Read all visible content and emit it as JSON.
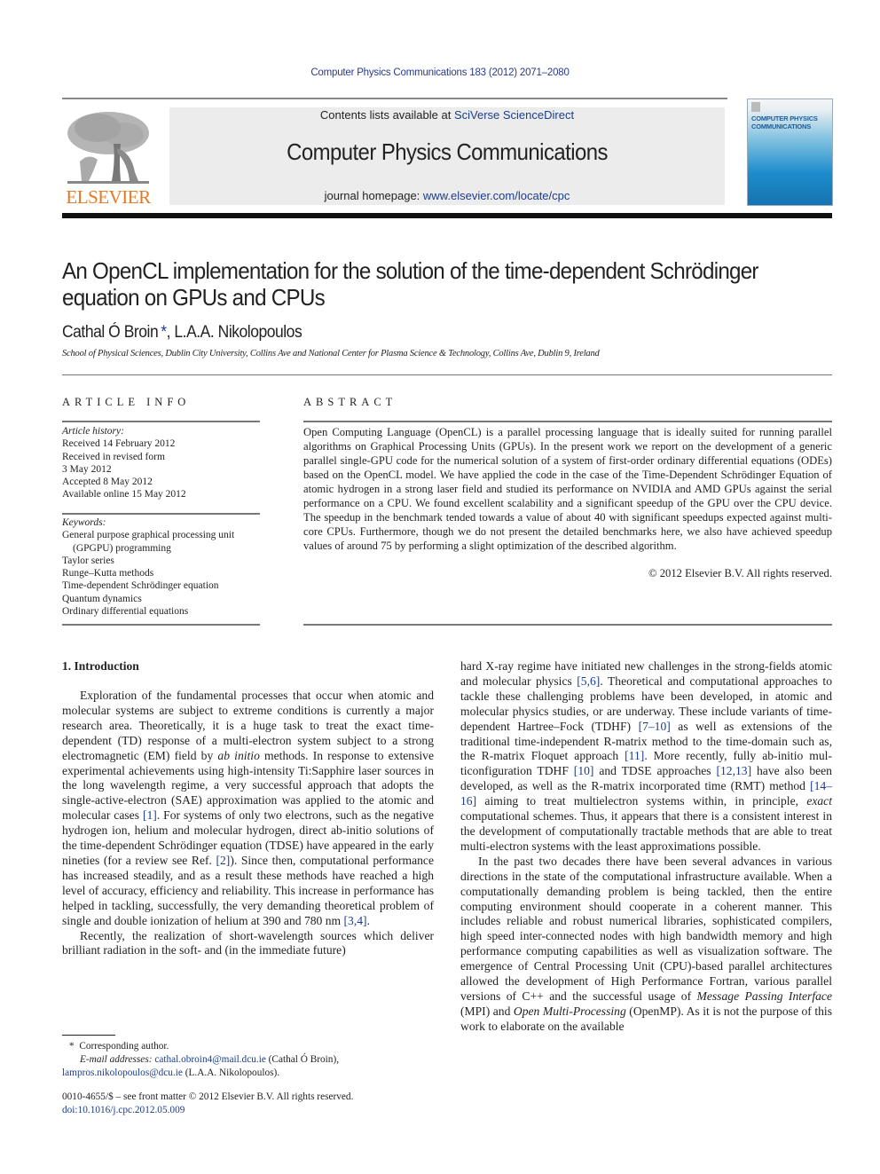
{
  "header": {
    "journal_reference": "Computer Physics Communications 183 (2012) 2071–2080",
    "contents_prefix": "Contents lists available at ",
    "contents_link": "SciVerse ScienceDirect",
    "journal_title": "Computer Physics Communications",
    "homepage_prefix": "journal homepage: ",
    "homepage_link": "www.elsevier.com/locate/cpc",
    "publisher_logo_text": "ELSEVIER",
    "cover_title_line1": "COMPUTER PHYSICS",
    "cover_title_line2": "COMMUNICATIONS"
  },
  "article": {
    "title": "An OpenCL implementation for the solution of the time-dependent Schrödinger equation on GPUs and CPUs",
    "authors": [
      {
        "name": "Cathal Ó Broin",
        "mark": "*"
      },
      {
        "name": "L.A.A. Nikolopoulos",
        "mark": ""
      }
    ],
    "author_separator": ", ",
    "affiliation": "School of Physical Sciences, Dublin City University, Collins Ave and National Center for Plasma Science & Technology, Collins Ave, Dublin 9, Ireland"
  },
  "article_info": {
    "heading": "ARTICLE INFO",
    "history_label": "Article history:",
    "history": [
      "Received 14 February 2012",
      "Received in revised form",
      "3 May 2012",
      "Accepted 8 May 2012",
      "Available online 15 May 2012"
    ],
    "keywords_label": "Keywords:",
    "keywords": [
      "General purpose graphical processing unit",
      "(GPGPU) programming",
      "Taylor series",
      "Runge–Kutta methods",
      "Time-dependent Schrödinger equation",
      "Quantum dynamics",
      "Ordinary differential equations"
    ]
  },
  "abstract": {
    "heading": "ABSTRACT",
    "text": "Open Computing Language (OpenCL) is a parallel processing language that is ideally suited for running parallel algorithms on Graphical Processing Units (GPUs). In the present work we report on the development of a generic parallel single-GPU code for the numerical solution of a system of first-order ordinary differential equations (ODEs) based on the OpenCL model. We have applied the code in the case of the Time-Dependent Schrödinger Equation of atomic hydrogen in a strong laser field and studied its performance on NVIDIA and AMD GPUs against the serial performance on a CPU. We found excellent scalability and a significant speedup of the GPU over the CPU device. The speedup in the benchmark tended towards a value of about 40 with significant speedups expected against multi-core CPUs. Furthermore, though we do not present the detailed benchmarks here, we also have achieved speedup values of around 75 by performing a slight optimization of the described algorithm.",
    "copyright": "© 2012 Elsevier B.V. All rights reserved."
  },
  "body": {
    "section_heading": "1.  Introduction",
    "col1": {
      "p1": [
        {
          "t": "Exploration of the fundamental processes that occur when atomic and molecular systems are subject to extreme conditions is currently a major research area. Theoretically, it is a huge task to treat the exact time-dependent (TD) response of a multi-electron system subject to a strong electromagnetic (EM) field by "
        },
        {
          "i": "ab ini­tio"
        },
        {
          "t": " methods. In response to extensive experimental achievements using high-intensity Ti:Sapphire laser sources in the long wave­length regime, a very successful approach that adopts the single-active-electron (SAE) approximation was applied to the atomic and molecular cases "
        },
        {
          "r": "[1]"
        },
        {
          "t": ". For systems of only two electrons, such as the negative hydrogen ion, helium and molecular hydrogen, di­rect ab-initio solutions of the time-dependent Schrödinger equa­tion (TDSE) have appeared in the early nineties (for a review see Ref. "
        },
        {
          "r": "[2]"
        },
        {
          "t": "). Since then, computational performance has increased steadily, and as a result these methods have reached a high level of accuracy, efficiency and reliability. This increase in performance has helped in tackling, successfully, the very demanding theoret­ical problem of single and double ionization of helium at 390 and 780 nm "
        },
        {
          "r": "[3,4]"
        },
        {
          "t": "."
        }
      ],
      "p2": [
        {
          "t": "Recently, the realization of short-wavelength sources which de­liver brilliant radiation in the soft- and (in the immediate future)"
        }
      ]
    },
    "col2": {
      "p1": [
        {
          "t": "hard X-ray regime have initiated new challenges in the strong-fields atomic and molecular physics "
        },
        {
          "r": "[5,6]"
        },
        {
          "t": ". Theoretical and com­putational approaches to tackle these challenging problems have been developed, in atomic and molecular physics studies, or are underway. These include variants of time-dependent Hartree–Fock (TDHF) "
        },
        {
          "r": "[7–10]"
        },
        {
          "t": " as well as extensions of the traditional time-independent R-matrix method to the time-domain such as, the R-matrix Floquet approach "
        },
        {
          "r": "[11]"
        },
        {
          "t": ". More recently, fully ab-initio mul­ticonfiguration TDHF "
        },
        {
          "r": "[10]"
        },
        {
          "t": " and TDSE approaches "
        },
        {
          "r": "[12,13]"
        },
        {
          "t": " have also been developed, as well as the R-matrix incorporated time (RMT) method "
        },
        {
          "r": "[14–16]"
        },
        {
          "t": " aiming to treat multielectron systems within, in principle, "
        },
        {
          "i": "exact"
        },
        {
          "t": " computational schemes. Thus, it appears that there is a consistent interest in the development of computationally tractable methods that are able to treat multi-electron systems with the least approximations possible."
        }
      ],
      "p2": [
        {
          "t": "In the past two decades there have been several advances in various directions in the state of the computational infrastructure available. When a computationally demanding problem is being tackled, then the entire computing environment should cooperate in a coherent manner. This includes reliable and robust numeri­cal libraries, sophisticated compilers, high speed inter-connected nodes with high bandwidth memory and high performance computing capabilities as well as visualization software. The emer­gence of Central Processing Unit (CPU)-based parallel architec­tures allowed the development of High Performance Fortran, various parallel versions of C++ and the successful usage of "
        },
        {
          "i": "Mes­sage Passing Interface"
        },
        {
          "t": " (MPI) and "
        },
        {
          "i": "Open Multi-Processing"
        },
        {
          "t": " (OpenMP). As it is not the purpose of this work to elaborate on the available"
        }
      ]
    }
  },
  "footnotes": {
    "star": "*",
    "corresponding": "Corresponding author.",
    "email_label": "E-mail addresses:",
    "email1": "cathal.obroin4@mail.dcu.ie",
    "email1_owner": " (Cathal Ó Broin),",
    "email2": "lampros.nikolopoulos@dcu.ie",
    "email2_owner": " (L.A.A. Nikolopoulos).",
    "issn_line": "0010-4655/$ – see front matter © 2012 Elsevier B.V. All rights reserved.",
    "doi": "doi:10.1016/j.cpc.2012.05.009"
  },
  "colors": {
    "link": "#1a3d8f",
    "elsevier_orange": "#e87722",
    "banner_bg": "#ececec"
  }
}
